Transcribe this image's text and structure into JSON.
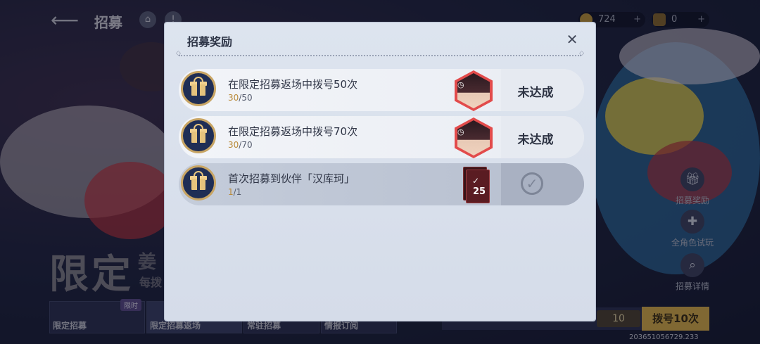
{
  "header": {
    "back_icon": "back-arrow-icon",
    "title": "招募",
    "home_icon": "home-icon",
    "info_label": "!",
    "currencies": [
      {
        "icon": "gold-coin-icon",
        "value": "724",
        "plus": "+"
      },
      {
        "icon": "ticket-icon",
        "value": "0",
        "plus": "+"
      }
    ]
  },
  "background": {
    "banner_title": "限定",
    "banner_sub": "姜",
    "banner_line": "每拨"
  },
  "side_menu": [
    {
      "icon": "gift-icon",
      "label": "招募奖励"
    },
    {
      "icon": "gamepad-icon",
      "label": "全角色试玩"
    },
    {
      "icon": "magnifier-icon",
      "label": "招募详情"
    }
  ],
  "bottom_tabs": [
    {
      "label": "限定招募",
      "tag": "限时"
    },
    {
      "label": "限定招募返场"
    },
    {
      "label": "常驻招募"
    },
    {
      "label": "情报订阅"
    }
  ],
  "dial": {
    "count": "10",
    "button_label": "拨号10次"
  },
  "uid": "203651056729.233",
  "modal": {
    "title": "招募奖励",
    "close_icon": "close-x-icon",
    "rewards": [
      {
        "title": "在限定招募返场中拨号50次",
        "progress_current": "30",
        "progress_total": "/50",
        "reward_icon": "character-portrait-icon",
        "status": "未达成",
        "completed": false
      },
      {
        "title": "在限定招募返场中拨号70次",
        "progress_current": "30",
        "progress_total": "/70",
        "reward_icon": "character-portrait-icon",
        "status": "未达成",
        "completed": false
      },
      {
        "title": "首次招募到伙伴「汉库珂」",
        "progress_current": "1",
        "progress_total": "/1",
        "reward_icon": "card-pack-icon",
        "reward_count": "25",
        "status": "claimed",
        "completed": true
      }
    ]
  }
}
